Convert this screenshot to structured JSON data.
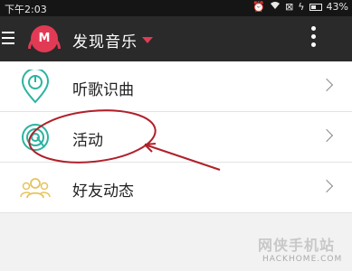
{
  "status_bar": {
    "time": "下午2:03",
    "battery_percent": "43%",
    "icons": [
      "alarm-icon",
      "wifi-icon",
      "no-sim-icon",
      "charging-icon",
      "battery-icon"
    ]
  },
  "app_bar": {
    "logo_letter": "M",
    "title": "发现音乐",
    "menu_icon": "hamburger-icon",
    "overflow_icon": "overflow-menu-icon"
  },
  "list": {
    "items": [
      {
        "label": "听歌识曲",
        "icon": "song-recognition-icon"
      },
      {
        "label": "活动",
        "icon": "activity-icon"
      },
      {
        "label": "好友动态",
        "icon": "friends-icon"
      }
    ]
  },
  "colors": {
    "brand": "#e23a55",
    "activity_icon": "#2bb3a0",
    "friends_icon": "#e6c35a",
    "annotation": "#b0202a"
  },
  "watermark": {
    "text": "网侠手机站",
    "domain": "HACKHOME.COM"
  }
}
